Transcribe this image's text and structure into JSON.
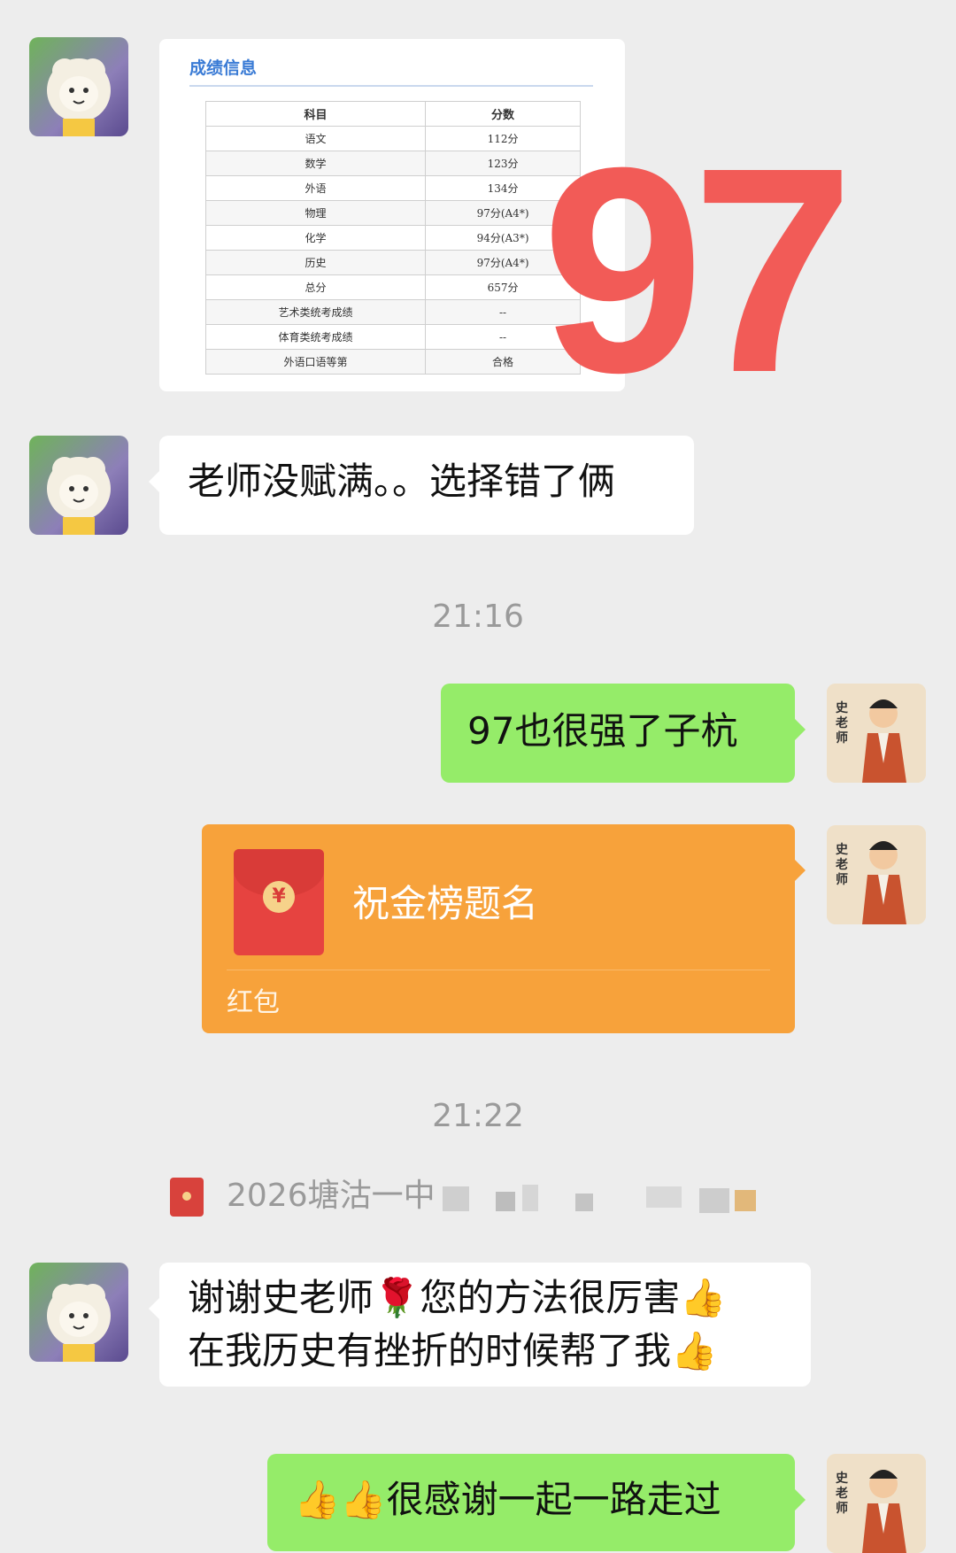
{
  "score_card": {
    "title": "成绩信息",
    "headers": [
      "科目",
      "分数"
    ],
    "rows": [
      [
        "语文",
        "112分"
      ],
      [
        "数学",
        "123分"
      ],
      [
        "外语",
        "134分"
      ],
      [
        "物理",
        "97分(A4*)"
      ],
      [
        "化学",
        "94分(A3*)"
      ],
      [
        "历史",
        "97分(A4*)"
      ],
      [
        "总分",
        "657分"
      ],
      [
        "艺术类统考成绩",
        "--"
      ],
      [
        "体育类统考成绩",
        "--"
      ],
      [
        "外语口语等第",
        "合格"
      ]
    ],
    "overlay_number": "97",
    "overlay_color": "#f25b57"
  },
  "messages": {
    "m1": "老师没赋满。。选择错了俩",
    "ts1": "21:16",
    "m2": "97也很强了子杭",
    "packet_title": "祝金榜题名",
    "packet_label": "红包",
    "packet_icon": "¥",
    "ts2": "21:22",
    "notice": "2026塘沽一中",
    "m3_line1": "谢谢史老师🌹您的方法很厉害👍",
    "m3_line2": "在我历史有挫折的时候帮了我👍",
    "m4": "👍👍很感谢一起一路走过"
  },
  "teacher_avatar_text": "史老师",
  "colors": {
    "background": "#ededed",
    "self_bubble": "#95ec69",
    "other_bubble": "#ffffff",
    "red_packet": "#f7a23b"
  }
}
